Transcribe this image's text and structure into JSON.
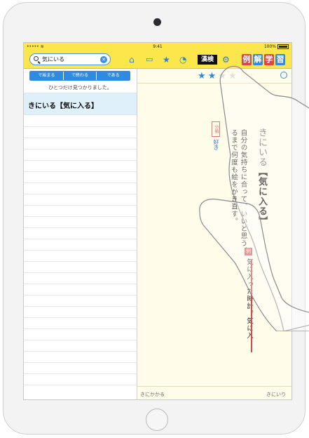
{
  "status_bar": {
    "time": "9:41",
    "battery": "100%"
  },
  "toolbar": {
    "search_query": "気にいる",
    "kanken": "漢検",
    "badge_example": "例",
    "badge_kai": "解",
    "badge_gaku": "学",
    "badge_shu": "習"
  },
  "left_panel": {
    "tabs": [
      "で始まる",
      "で終わる",
      "である"
    ],
    "found_text": "ひとつだけ見つかりました。",
    "result": "きにいる【気に入る】"
  },
  "entry": {
    "headword_kana": "きにいる",
    "headword_kanji": "【気に入る】",
    "definition_line1": "自分の気持ちに合って、いいと思う。",
    "definition_line2": "るまで何度も絵をかき直す。",
    "category_label": "分類",
    "category_value": "好き",
    "example_mark": "例",
    "example": "気に入った時計。気に入",
    "stars_filled": 2,
    "stars_total": 4
  },
  "footer": {
    "prev": "きにかかる",
    "next": "きにいり"
  },
  "colors": {
    "toolbar": "#fbe64b",
    "accent": "#2f8be0",
    "selected_row": "#dff0fb",
    "example_red": "#d84a4a"
  }
}
